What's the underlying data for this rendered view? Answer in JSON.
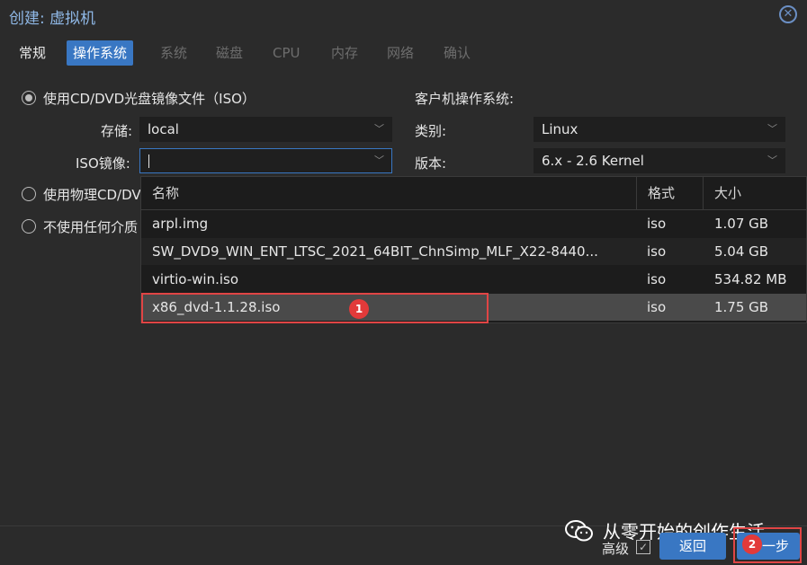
{
  "window": {
    "title": "创建: 虚拟机",
    "close_symbol": "✕"
  },
  "tabs": [
    {
      "label": "常规"
    },
    {
      "label": "操作系统"
    },
    {
      "label": "系统"
    },
    {
      "label": "磁盘"
    },
    {
      "label": "CPU"
    },
    {
      "label": "内存"
    },
    {
      "label": "网络"
    },
    {
      "label": "确认"
    }
  ],
  "media": {
    "option_iso": "使用CD/DVD光盘镜像文件（ISO）",
    "option_physical": "使用物理CD/DV",
    "option_none": "不使用任何介质",
    "storage_label": "存储:",
    "storage_value": "local",
    "iso_label": "ISO镜像:",
    "iso_value": ""
  },
  "guest_os": {
    "heading": "客户机操作系统:",
    "type_label": "类别:",
    "type_value": "Linux",
    "version_label": "版本:",
    "version_value": "6.x - 2.6 Kernel"
  },
  "iso_list": {
    "columns": [
      "名称",
      "格式",
      "大小"
    ],
    "rows": [
      {
        "name": "arpl.img",
        "format": "iso",
        "size": "1.07 GB"
      },
      {
        "name": "SW_DVD9_WIN_ENT_LTSC_2021_64BIT_ChnSimp_MLF_X22-8440...",
        "format": "iso",
        "size": "5.04 GB"
      },
      {
        "name": "virtio-win.iso",
        "format": "iso",
        "size": "534.82 MB"
      },
      {
        "name": "x86_dvd-1.1.28.iso",
        "format": "iso",
        "size": "1.75 GB"
      }
    ]
  },
  "annotations": {
    "step1": "1",
    "step2": "2"
  },
  "footer": {
    "advanced_label": "高级",
    "back_label": "返回",
    "next_label": "一步"
  },
  "watermark": "从零开始的创作生活",
  "colors": {
    "accent": "#3977c3",
    "highlight": "#e04545"
  }
}
